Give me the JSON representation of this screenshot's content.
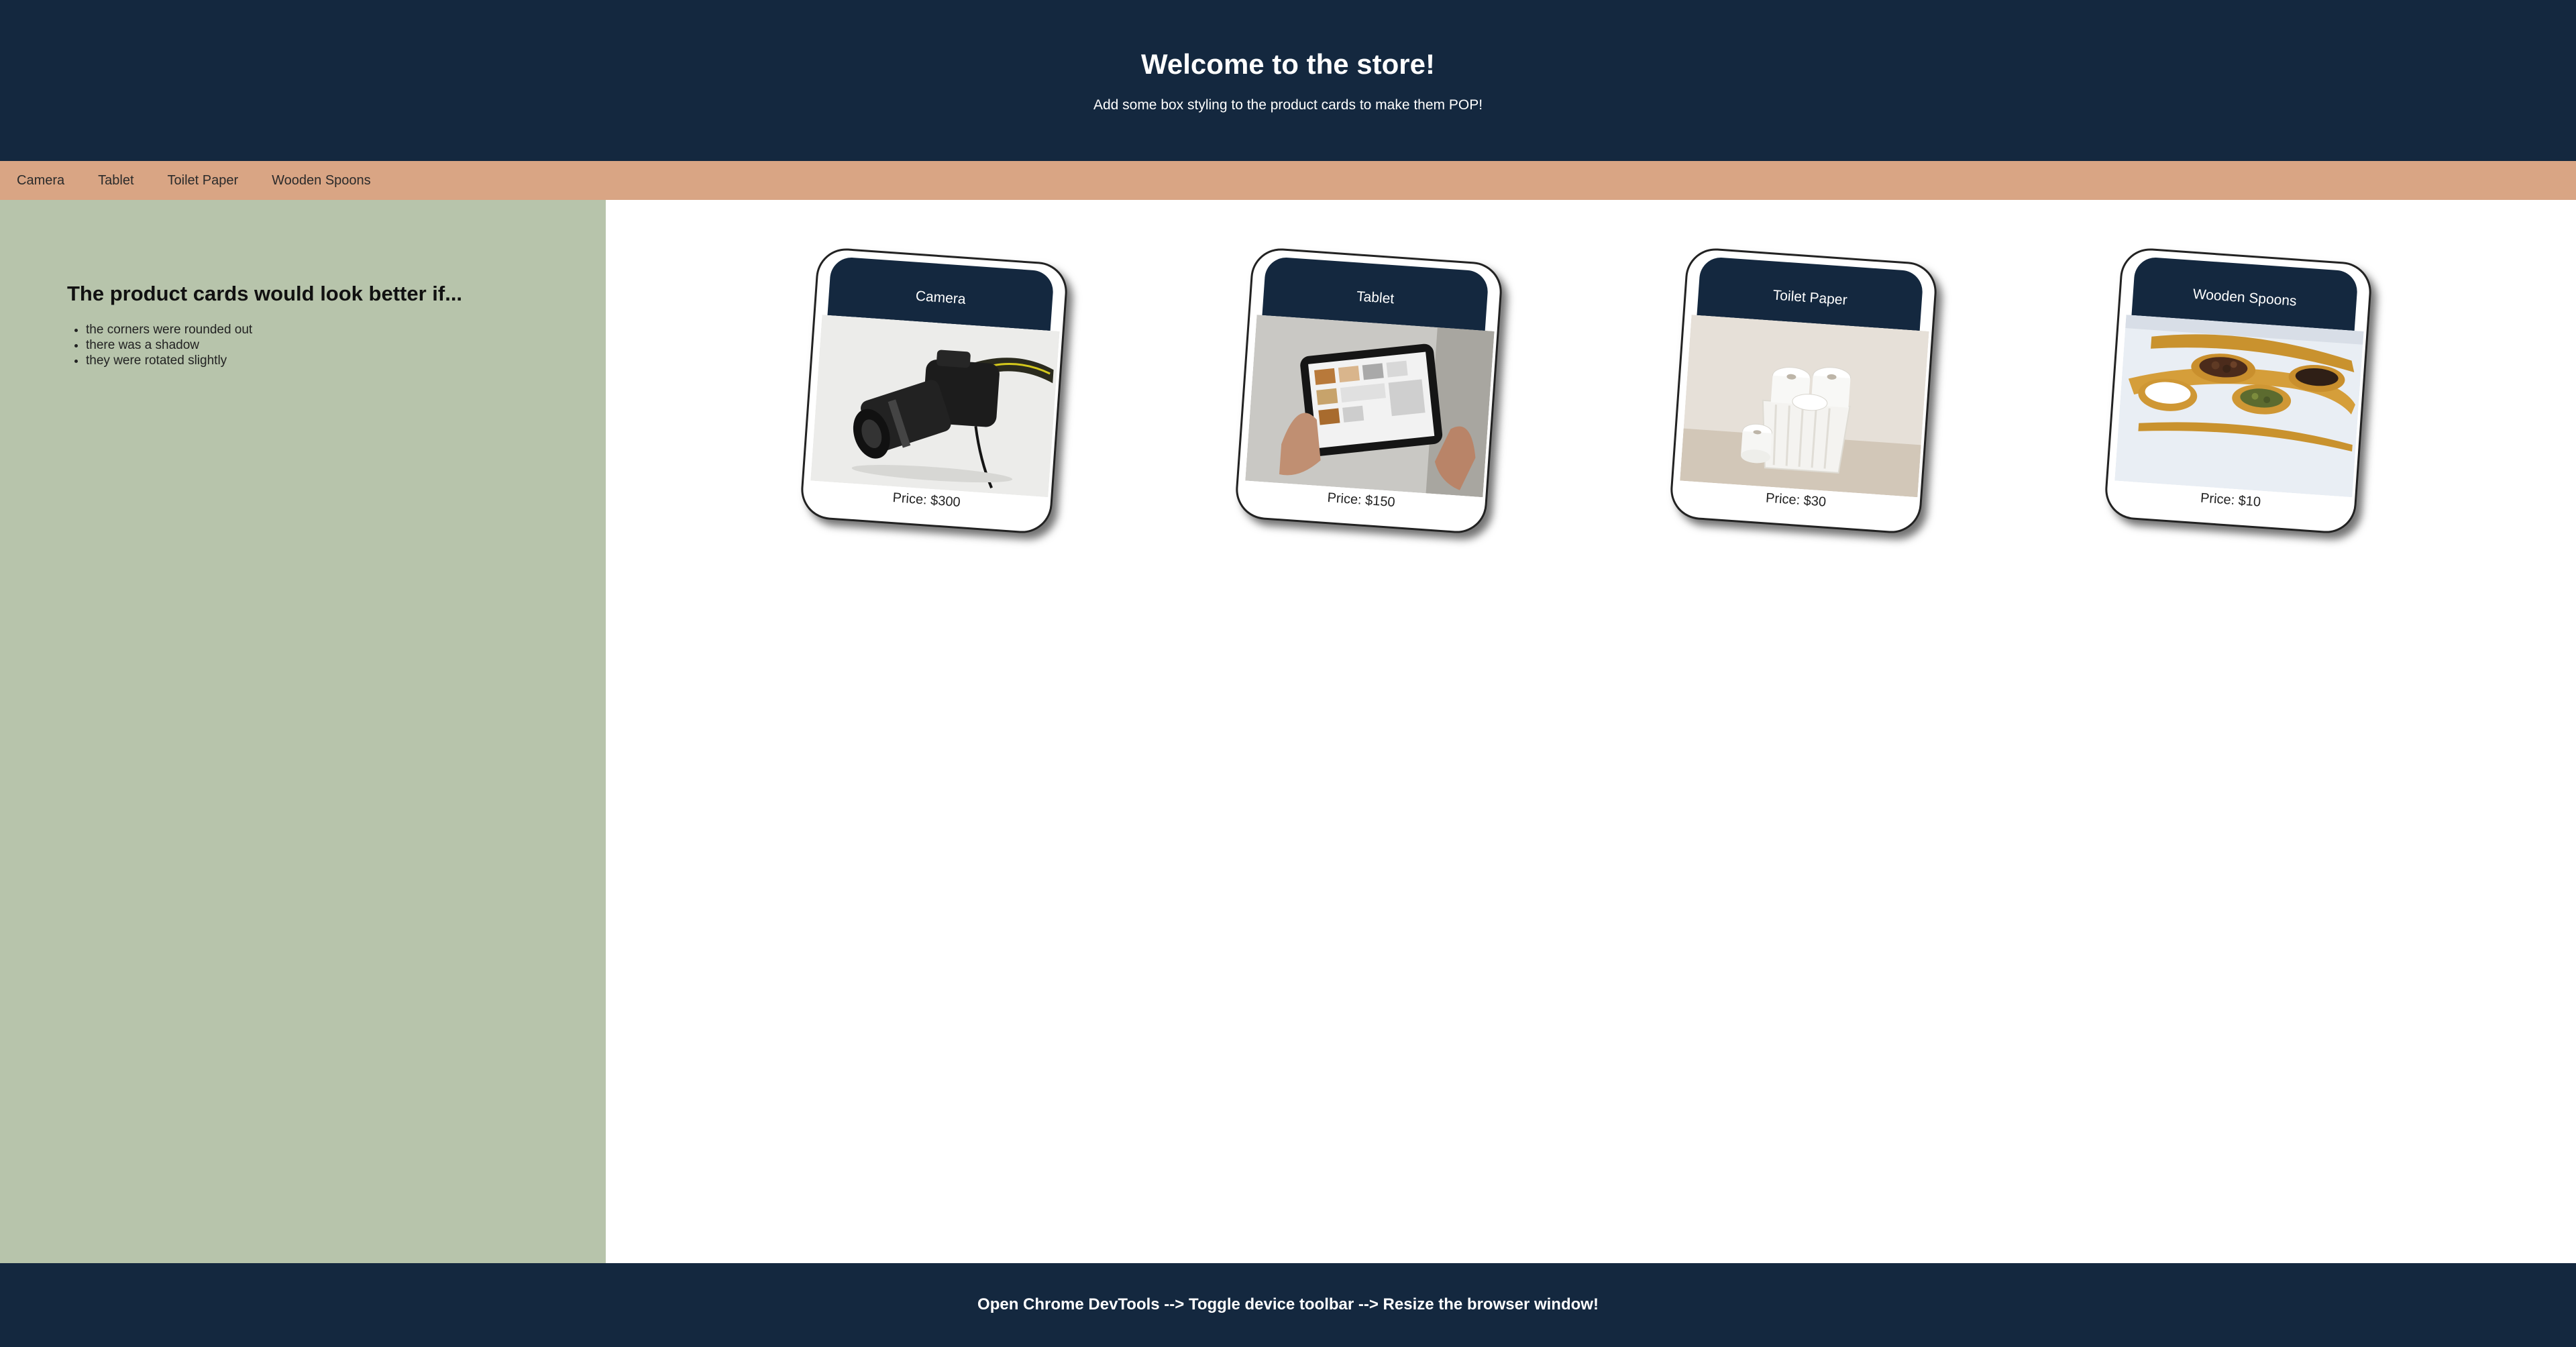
{
  "header": {
    "title": "Welcome to the store!",
    "subtitle": "Add some box styling to the product cards to make them POP!"
  },
  "nav": {
    "items": [
      {
        "label": "Camera"
      },
      {
        "label": "Tablet"
      },
      {
        "label": "Toilet Paper"
      },
      {
        "label": "Wooden Spoons"
      }
    ]
  },
  "sidebar": {
    "heading": "The product cards would look better if...",
    "items": [
      {
        "text": "the corners were rounded out"
      },
      {
        "text": "there was a shadow"
      },
      {
        "text": "they were rotated slightly"
      }
    ]
  },
  "products": [
    {
      "name": "Camera",
      "price": "Price: $300",
      "image": "camera-photo"
    },
    {
      "name": "Tablet",
      "price": "Price: $150",
      "image": "tablet-photo"
    },
    {
      "name": "Toilet Paper",
      "price": "Price: $30",
      "image": "toilet-paper-photo"
    },
    {
      "name": "Wooden Spoons",
      "price": "Price: $10",
      "image": "wooden-spoons-photo"
    }
  ],
  "footer": {
    "text": "Open Chrome DevTools --> Toggle device toolbar --> Resize the browser window!"
  },
  "colors": {
    "header_bg": "#14283f",
    "nav_bg": "#d9a584",
    "sidebar_bg": "#b7c4ab",
    "footer_bg": "#14283f"
  }
}
